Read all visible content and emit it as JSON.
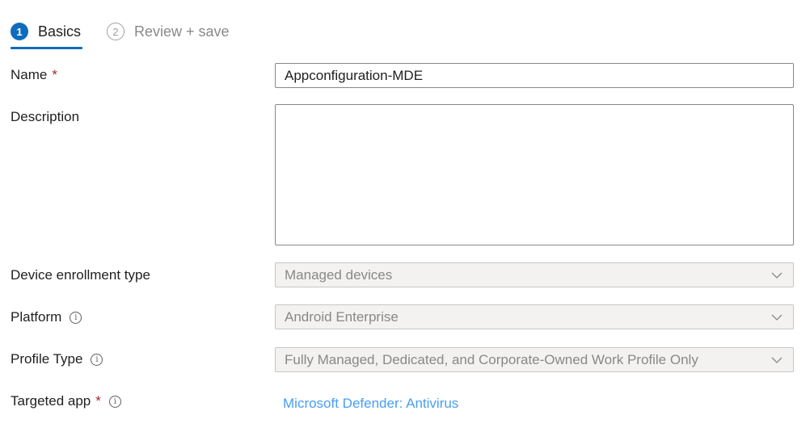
{
  "tabs": [
    {
      "number": "1",
      "label": "Basics"
    },
    {
      "number": "2",
      "label": "Review + save"
    }
  ],
  "form": {
    "name": {
      "label": "Name",
      "required_mark": "*",
      "value": "Appconfiguration-MDE"
    },
    "description": {
      "label": "Description",
      "value": ""
    },
    "enrollment": {
      "label": "Device enrollment type",
      "value": "Managed devices"
    },
    "platform": {
      "label": "Platform",
      "value": "Android Enterprise"
    },
    "profile_type": {
      "label": "Profile Type",
      "value": "Fully Managed, Dedicated, and Corporate-Owned Work Profile Only"
    },
    "targeted_app": {
      "label": "Targeted app",
      "required_mark": "*",
      "value": "Microsoft Defender: Antivirus"
    }
  },
  "icons": {
    "info": "info-icon",
    "dropdown": "chevron-down-icon"
  },
  "colors": {
    "accent": "#0f6cbd",
    "required": "#a4262c",
    "link": "#479ef5"
  }
}
